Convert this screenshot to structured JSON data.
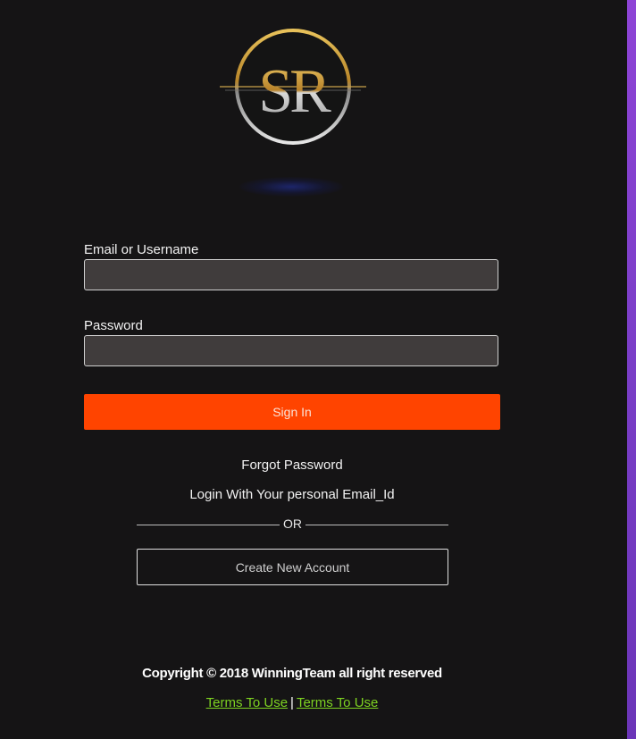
{
  "logo": {
    "text": "SR",
    "colors": {
      "gold": "#d4a73a",
      "silver": "#cfcfcf"
    }
  },
  "form": {
    "email_label": "Email or Username",
    "email_value": "",
    "password_label": "Password",
    "password_value": "",
    "signin_label": "Sign In"
  },
  "links": {
    "forgot_password": "Forgot Password",
    "personal_email_login": "Login With Your personal Email_Id",
    "or_divider": "OR",
    "create_account": "Create New Account"
  },
  "footer": {
    "copyright": "Copyright © 2018 WinningTeam all right reserved",
    "terms_1": "Terms To Use",
    "separator": "|",
    "terms_2": "Terms To Use"
  },
  "colors": {
    "background": "#151415",
    "primary_button": "#ff4400",
    "input_background": "#403c3c",
    "link_green": "#7ed321",
    "side_strip": "#8e44d6"
  }
}
